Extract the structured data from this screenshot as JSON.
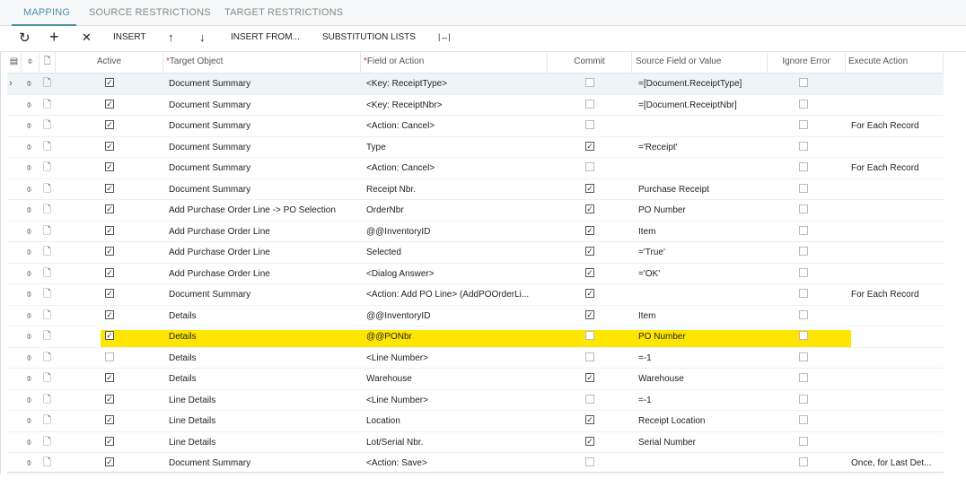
{
  "tabs": [
    "MAPPING",
    "SOURCE RESTRICTIONS",
    "TARGET RESTRICTIONS"
  ],
  "toolbar": {
    "refresh": "↻",
    "add": "+",
    "delete": "✕",
    "insert": "INSERT",
    "up": "↑",
    "down": "↓",
    "insert_from": "INSERT FROM...",
    "substitution_lists": "SUBSTITUTION LISTS",
    "fit": "|↔|"
  },
  "columns": {
    "active": "Active",
    "target": "Target Object",
    "field": "Field or Action",
    "commit": "Commit",
    "source": "Source Field or Value",
    "ignore": "Ignore Error",
    "execute": "Execute Action"
  },
  "rows": [
    {
      "active": true,
      "target": "Document Summary",
      "field": "<Key: ReceiptType>",
      "commit": false,
      "source": "=[Document.ReceiptType]",
      "ignore": false,
      "execute": ""
    },
    {
      "active": true,
      "target": "Document Summary",
      "field": "<Key: ReceiptNbr>",
      "commit": false,
      "source": "=[Document.ReceiptNbr]",
      "ignore": false,
      "execute": ""
    },
    {
      "active": true,
      "target": "Document Summary",
      "field": "<Action: Cancel>",
      "commit": false,
      "source": "",
      "ignore": false,
      "execute": "For Each Record"
    },
    {
      "active": true,
      "target": "Document Summary",
      "field": "Type",
      "commit": true,
      "source": "='Receipt'",
      "ignore": false,
      "execute": ""
    },
    {
      "active": true,
      "target": "Document Summary",
      "field": "<Action: Cancel>",
      "commit": false,
      "source": "",
      "ignore": false,
      "execute": "For Each Record"
    },
    {
      "active": true,
      "target": "Document Summary",
      "field": "Receipt Nbr.",
      "commit": true,
      "source": "Purchase Receipt",
      "ignore": false,
      "execute": ""
    },
    {
      "active": true,
      "target": "Add Purchase Order Line -> PO Selection",
      "field": "OrderNbr",
      "commit": true,
      "source": "PO Number",
      "ignore": false,
      "execute": ""
    },
    {
      "active": true,
      "target": "Add Purchase Order Line",
      "field": "@@InventoryID",
      "commit": true,
      "source": "Item",
      "ignore": false,
      "execute": ""
    },
    {
      "active": true,
      "target": "Add Purchase Order Line",
      "field": "Selected",
      "commit": true,
      "source": "='True'",
      "ignore": false,
      "execute": ""
    },
    {
      "active": true,
      "target": "Add Purchase Order Line",
      "field": "<Dialog Answer>",
      "commit": true,
      "source": "='OK'",
      "ignore": false,
      "execute": ""
    },
    {
      "active": true,
      "target": "Document Summary",
      "field": "<Action: Add PO Line> (AddPOOrderLi...",
      "commit": true,
      "source": "",
      "ignore": false,
      "execute": "For Each Record"
    },
    {
      "active": true,
      "target": "Details",
      "field": "@@InventoryID",
      "commit": true,
      "source": "Item",
      "ignore": false,
      "execute": ""
    },
    {
      "active": true,
      "target": "Details",
      "field": "@@PONbr",
      "commit": false,
      "source": "PO Number",
      "ignore": false,
      "execute": "",
      "highlighted": true
    },
    {
      "active": false,
      "target": "Details",
      "field": "<Line Number>",
      "commit": false,
      "source": "=-1",
      "ignore": false,
      "execute": ""
    },
    {
      "active": true,
      "target": "Details",
      "field": "Warehouse",
      "commit": true,
      "source": "Warehouse",
      "ignore": false,
      "execute": ""
    },
    {
      "active": true,
      "target": "Line Details",
      "field": "<Line Number>",
      "commit": false,
      "source": "=-1",
      "ignore": false,
      "execute": ""
    },
    {
      "active": true,
      "target": "Line Details",
      "field": "Location",
      "commit": true,
      "source": "Receipt Location",
      "ignore": false,
      "execute": ""
    },
    {
      "active": true,
      "target": "Line Details",
      "field": "Lot/Serial Nbr.",
      "commit": true,
      "source": "Serial Number",
      "ignore": false,
      "execute": ""
    },
    {
      "active": true,
      "target": "Document Summary",
      "field": "<Action: Save>",
      "commit": false,
      "source": "",
      "ignore": false,
      "execute": "Once, for Last Det..."
    }
  ],
  "colors": {
    "accent": "#4a8fa6",
    "highlight": "#ffe600",
    "selected_row": "#eef5f7"
  }
}
